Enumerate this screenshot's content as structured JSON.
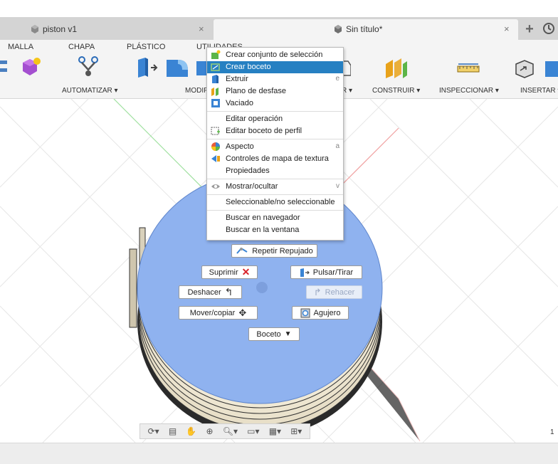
{
  "tabs": [
    {
      "label": "piston v1",
      "active": false
    },
    {
      "label": "Sin título*",
      "active": true
    }
  ],
  "ribbon": {
    "tabs": [
      "MALLA",
      "CHAPA",
      "PLÁSTICO",
      "UTILIDADES"
    ],
    "groups": [
      "AUTOMATIZAR ▾",
      "MODIF",
      "R ▾",
      "CONSTRUIR ▾",
      "INSPECCIONAR ▾",
      "INSERTAR ▾"
    ]
  },
  "context_menu": {
    "items": [
      {
        "label": "Crear conjunto de selección",
        "shortcut": "",
        "icon": "selection-set-icon"
      },
      {
        "label": "Crear boceto",
        "shortcut": "",
        "icon": "sketch-icon",
        "highlighted": true
      },
      {
        "label": "Extruir",
        "shortcut": "e",
        "icon": "extrude-icon"
      },
      {
        "label": "Plano de desfase",
        "shortcut": "",
        "icon": "offset-plane-icon"
      },
      {
        "label": "Vaciado",
        "shortcut": "",
        "icon": "shell-icon"
      },
      {
        "label": "Editar operación",
        "shortcut": "",
        "icon": ""
      },
      {
        "label": "Editar boceto de perfil",
        "shortcut": "",
        "icon": "edit-profile-sketch-icon"
      },
      {
        "label": "Aspecto",
        "shortcut": "a",
        "icon": "appearance-icon"
      },
      {
        "label": "Controles de mapa de textura",
        "shortcut": "",
        "icon": "texture-map-icon"
      },
      {
        "label": "Propiedades",
        "shortcut": "",
        "icon": ""
      },
      {
        "label": "Mostrar/ocultar",
        "shortcut": "v",
        "icon": "eye-icon"
      },
      {
        "label": "Seleccionable/no seleccionable",
        "shortcut": "",
        "icon": ""
      },
      {
        "label": "Buscar en navegador",
        "shortcut": "",
        "icon": ""
      },
      {
        "label": "Buscar en la ventana",
        "shortcut": "",
        "icon": ""
      }
    ]
  },
  "marking_menu": {
    "repeat": "Repetir Repujado",
    "delete": "Suprimir",
    "press_pull": "Pulsar/Tirar",
    "undo": "Deshacer",
    "redo": "Rehacer",
    "move_copy": "Mover/copiar",
    "hole": "Agujero",
    "sketch": "Boceto"
  },
  "viewport_corner": "1",
  "colors": {
    "face_blue": "#8fb2ef",
    "highlight": "#2680c2",
    "body_tan": "#e8dfc8"
  }
}
